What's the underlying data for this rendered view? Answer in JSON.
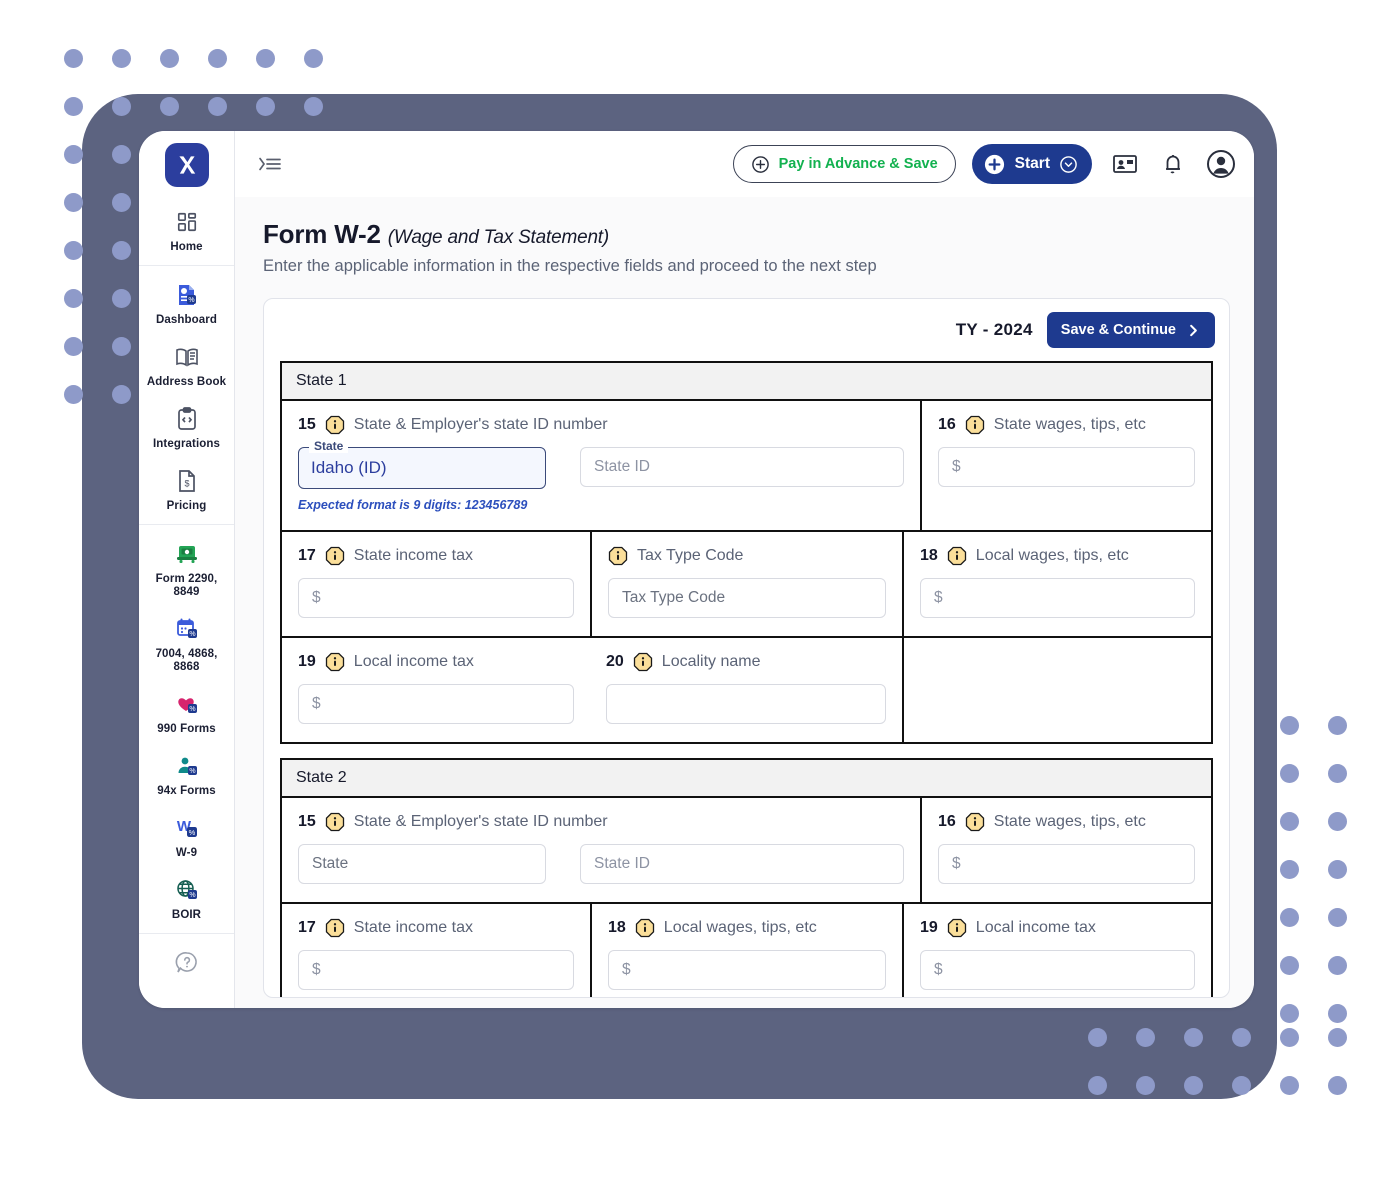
{
  "brand": {
    "logo_icon": "x-logo-icon",
    "accent": "#1e3a8f",
    "green": "#12b14f",
    "dot_color": "#8e9ac9",
    "frame_color": "#5c6380"
  },
  "topbar": {
    "collapse_icon": "collapse-menu-icon",
    "pay_advance_label": "Pay in Advance & Save",
    "pay_advance_icon": "plus-circle-icon",
    "start_label": "Start",
    "start_icon": "plus-circle-filled-icon",
    "start_caret_icon": "chevron-down-circle-icon",
    "contact_card_icon": "contact-card-icon",
    "bell_icon": "notification-bell-icon",
    "account_icon": "account-avatar-icon"
  },
  "sidebar": {
    "groups": [
      {
        "items": [
          {
            "label": "Home",
            "icon": "grid-home-icon"
          }
        ]
      },
      {
        "items": [
          {
            "label": "Dashboard",
            "icon": "dashboard-doc-icon"
          },
          {
            "label": "Address Book",
            "icon": "address-book-icon"
          },
          {
            "label": "Integrations",
            "icon": "integrations-code-icon"
          },
          {
            "label": "Pricing",
            "icon": "pricing-dollar-doc-icon"
          }
        ]
      },
      {
        "items": [
          {
            "label": "Form 2290, 8849",
            "icon": "truck-icon"
          },
          {
            "label": "7004, 4868, 8868",
            "icon": "calendar-icon"
          },
          {
            "label": "990 Forms",
            "icon": "heart-icon"
          },
          {
            "label": "94x Forms",
            "icon": "people-icon"
          },
          {
            "label": "W-9",
            "icon": "w9-icon"
          },
          {
            "label": "BOIR",
            "icon": "globe-icon"
          }
        ]
      },
      {
        "items": [
          {
            "label": "",
            "icon": "help-question-icon"
          }
        ]
      }
    ]
  },
  "page": {
    "title": "Form W-2",
    "title_sub": "(Wage and Tax Statement)",
    "description": "Enter the applicable information in the respective fields and proceed to the next step"
  },
  "card": {
    "tax_year_label": "TY - 2024",
    "save_continue_label": "Save & Continue",
    "save_continue_icon": "chevron-right-icon"
  },
  "state1": {
    "heading": "State 1",
    "f15": {
      "num": "15",
      "label": "State & Employer's state ID number",
      "state_legend": "State",
      "state_value": "Idaho (ID)",
      "state_id_placeholder": "State ID",
      "state_id_value": "",
      "hint": "Expected format is 9 digits: 123456789"
    },
    "f16": {
      "num": "16",
      "label": "State wages, tips, etc",
      "placeholder": "$",
      "value": ""
    },
    "f17": {
      "num": "17",
      "label": "State income tax",
      "placeholder": "$",
      "value": ""
    },
    "tax_type": {
      "label": "Tax Type Code",
      "placeholder": "Tax Type Code",
      "value": ""
    },
    "f18": {
      "num": "18",
      "label": "Local wages, tips, etc",
      "placeholder": "$",
      "value": ""
    },
    "f19": {
      "num": "19",
      "label": "Local income tax",
      "placeholder": "$",
      "value": ""
    },
    "f20": {
      "num": "20",
      "label": "Locality name",
      "placeholder": "",
      "value": ""
    }
  },
  "state2": {
    "heading": "State 2",
    "f15": {
      "num": "15",
      "label": "State & Employer's state ID number",
      "state_placeholder": "State",
      "state_value": "",
      "state_id_placeholder": "State ID",
      "state_id_value": ""
    },
    "f16": {
      "num": "16",
      "label": "State wages, tips, etc",
      "placeholder": "$",
      "value": ""
    },
    "f17": {
      "num": "17",
      "label": "State income tax",
      "placeholder": "$",
      "value": ""
    },
    "f18": {
      "num": "18",
      "label": "Local wages, tips, etc",
      "placeholder": "$",
      "value": ""
    },
    "f19": {
      "num": "19",
      "label": "Local income tax",
      "placeholder": "$",
      "value": ""
    }
  }
}
